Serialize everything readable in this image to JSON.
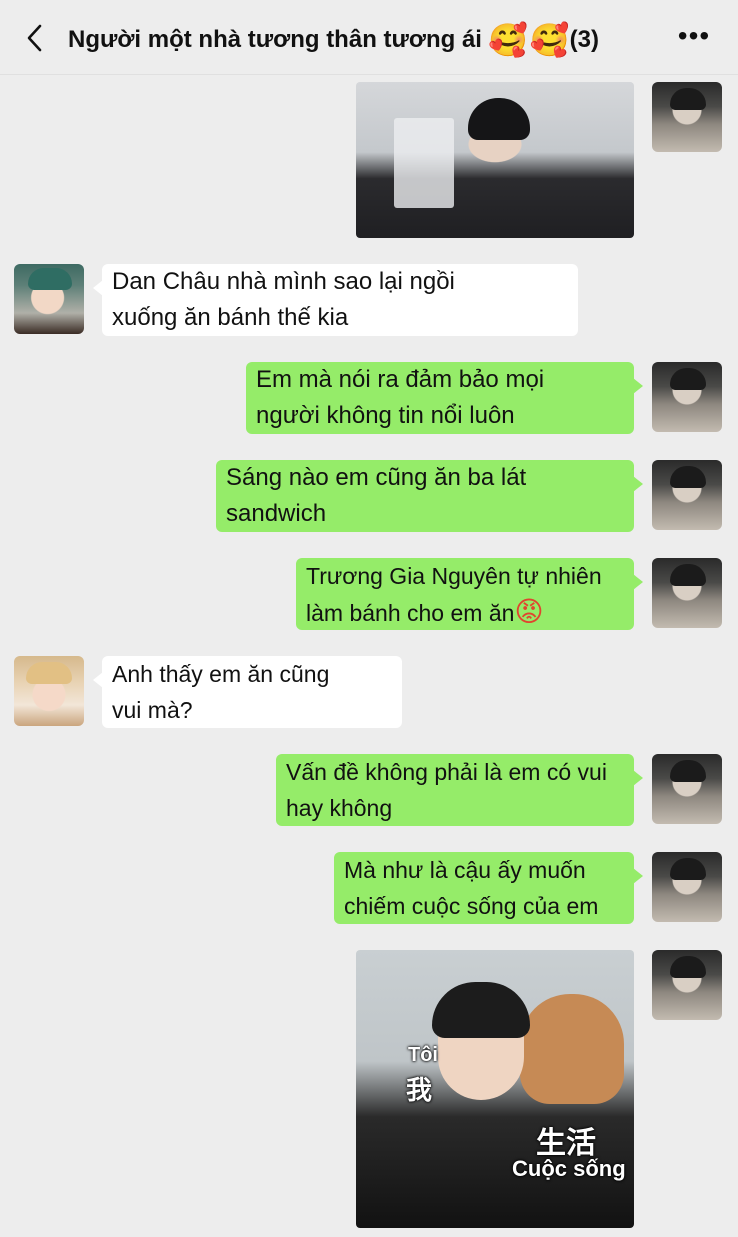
{
  "header": {
    "title": "Người một nhà tương thân tương ái",
    "emojis": [
      "🥰",
      "🥰"
    ],
    "member_count": "(3)",
    "more_label": "•••"
  },
  "messages": [
    {
      "sender": "self",
      "type": "image",
      "image_label": "photo"
    },
    {
      "sender": "friend",
      "type": "text",
      "lines": [
        "Dan Châu nhà mình sao lại ngồi",
        " xuống ăn bánh thế kia"
      ]
    },
    {
      "sender": "self",
      "type": "text",
      "lines": [
        "Em mà nói ra đảm bảo mọi",
        "người không tin nổi luôn"
      ]
    },
    {
      "sender": "self",
      "type": "text",
      "lines": [
        "Sáng nào em cũng ăn ba lát",
        "sandwich"
      ]
    },
    {
      "sender": "self",
      "type": "text",
      "lines": [
        "Trương Gia Nguyên tự nhiên",
        "làm bánh cho em ăn"
      ],
      "emoji": "😡"
    },
    {
      "sender": "friend",
      "type": "text",
      "lines": [
        "Anh thấy em ăn cũng",
        "vui mà?"
      ]
    },
    {
      "sender": "self",
      "type": "text",
      "lines": [
        "Vấn đề không phải là em có vui",
        "hay không"
      ]
    },
    {
      "sender": "self",
      "type": "text",
      "lines": [
        "Mà như là cậu ấy muốn",
        "chiếm cuộc sống của em"
      ]
    },
    {
      "sender": "self",
      "type": "image",
      "captions": {
        "toi": "Tôi",
        "wo": "我",
        "shenghuo": "生活",
        "cuocsong": "Cuộc sống"
      }
    }
  ],
  "colors": {
    "background": "#ededed",
    "my_bubble": "#95ec69",
    "their_bubble": "#ffffff"
  },
  "icons": [
    "chevron-left-icon",
    "more-icon"
  ]
}
